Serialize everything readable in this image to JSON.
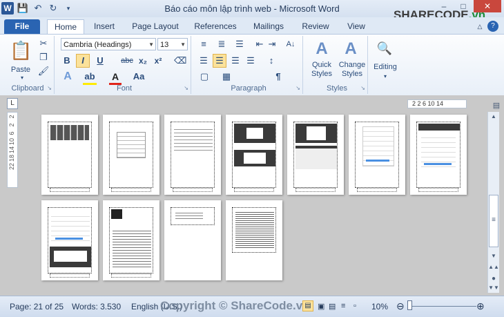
{
  "window": {
    "title": "Báo cáo môn lập trình web  -  Microsoft Word",
    "minimize": "–",
    "maximize": "□",
    "close": "✕"
  },
  "watermark": {
    "logo_text": "SHARECODE",
    "logo_suffix": ".vn",
    "bottom_text": "Copyright © ShareCode.vn"
  },
  "tabs": [
    "File",
    "Home",
    "Insert",
    "Page Layout",
    "References",
    "Mailings",
    "Review",
    "View"
  ],
  "ribbon": {
    "clipboard": {
      "label": "Clipboard",
      "paste": "Paste"
    },
    "font": {
      "label": "Font",
      "font_name": "Cambria (Headings)",
      "font_size": "13",
      "bold": "B",
      "italic": "I",
      "underline": "U",
      "strike": "abc",
      "sub": "x₂",
      "sup": "x²",
      "grow": "A",
      "shrink": "A",
      "case": "Aa"
    },
    "paragraph": {
      "label": "Paragraph",
      "show_marks": "¶"
    },
    "styles": {
      "label": "Styles",
      "quick": "Quick Styles",
      "change": "Change Styles"
    },
    "editing": {
      "label": "Editing"
    }
  },
  "rulers": {
    "vertical": [
      "2",
      "2",
      "6",
      "10",
      "14",
      "18",
      "22"
    ],
    "horizontal": "2  2  6  10  14"
  },
  "statusbar": {
    "page": "Page: 21 of 25",
    "words": "Words: 3.530",
    "language": "English (U.S.)",
    "zoom": "10%",
    "zoom_level": 0.1
  }
}
